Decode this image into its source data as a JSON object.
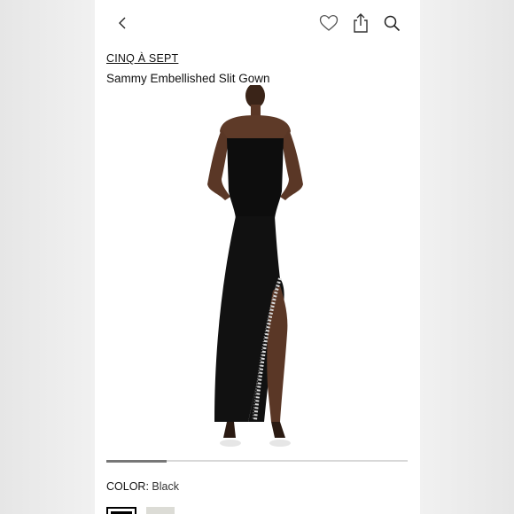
{
  "header": {
    "back_icon": "chevron-left-icon",
    "favorite_icon": "heart-icon",
    "share_icon": "share-icon",
    "search_icon": "search-icon"
  },
  "product": {
    "brand": "CINQ À SEPT",
    "name": "Sammy Embellished Slit Gown"
  },
  "gallery": {
    "progress_fraction": 0.2
  },
  "color": {
    "label": "COLOR:",
    "selected": "Black",
    "swatches": [
      "Black",
      "Ivory"
    ],
    "swatch_colors": [
      "#000000",
      "#dcdcd6"
    ]
  }
}
